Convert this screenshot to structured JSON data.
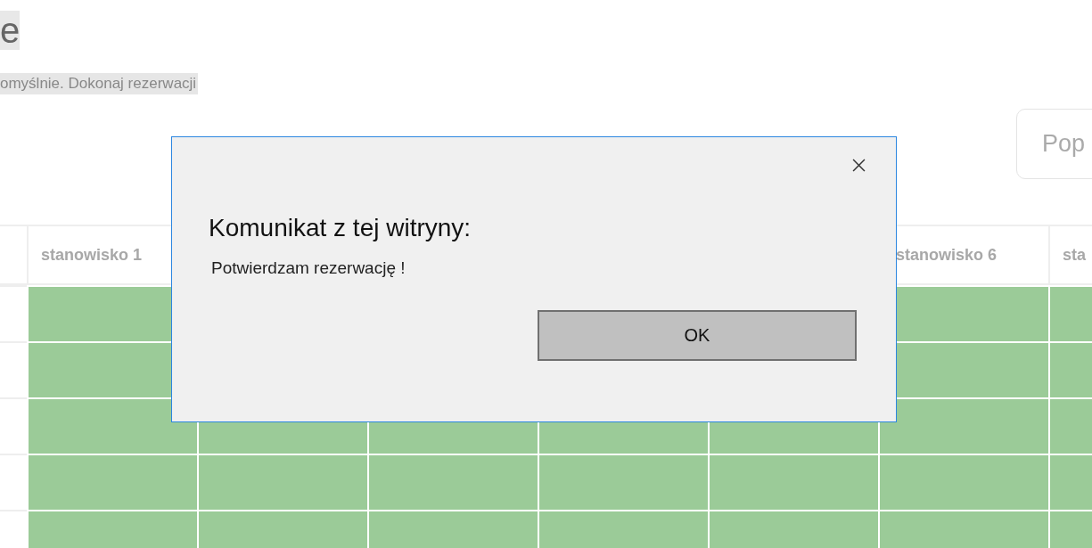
{
  "page": {
    "title": "e",
    "subtitle": "omyślnie. Dokonaj rezerwacji"
  },
  "toolbar": {
    "button": "Pop"
  },
  "table": {
    "columns": [
      "",
      "stanowisko 1",
      "",
      "",
      "",
      "",
      "stanowisko 6",
      "sta"
    ]
  },
  "dialog": {
    "title": "Komunikat z tej witryny:",
    "message": "Potwierdzam rezerwację !",
    "button": "OK"
  }
}
